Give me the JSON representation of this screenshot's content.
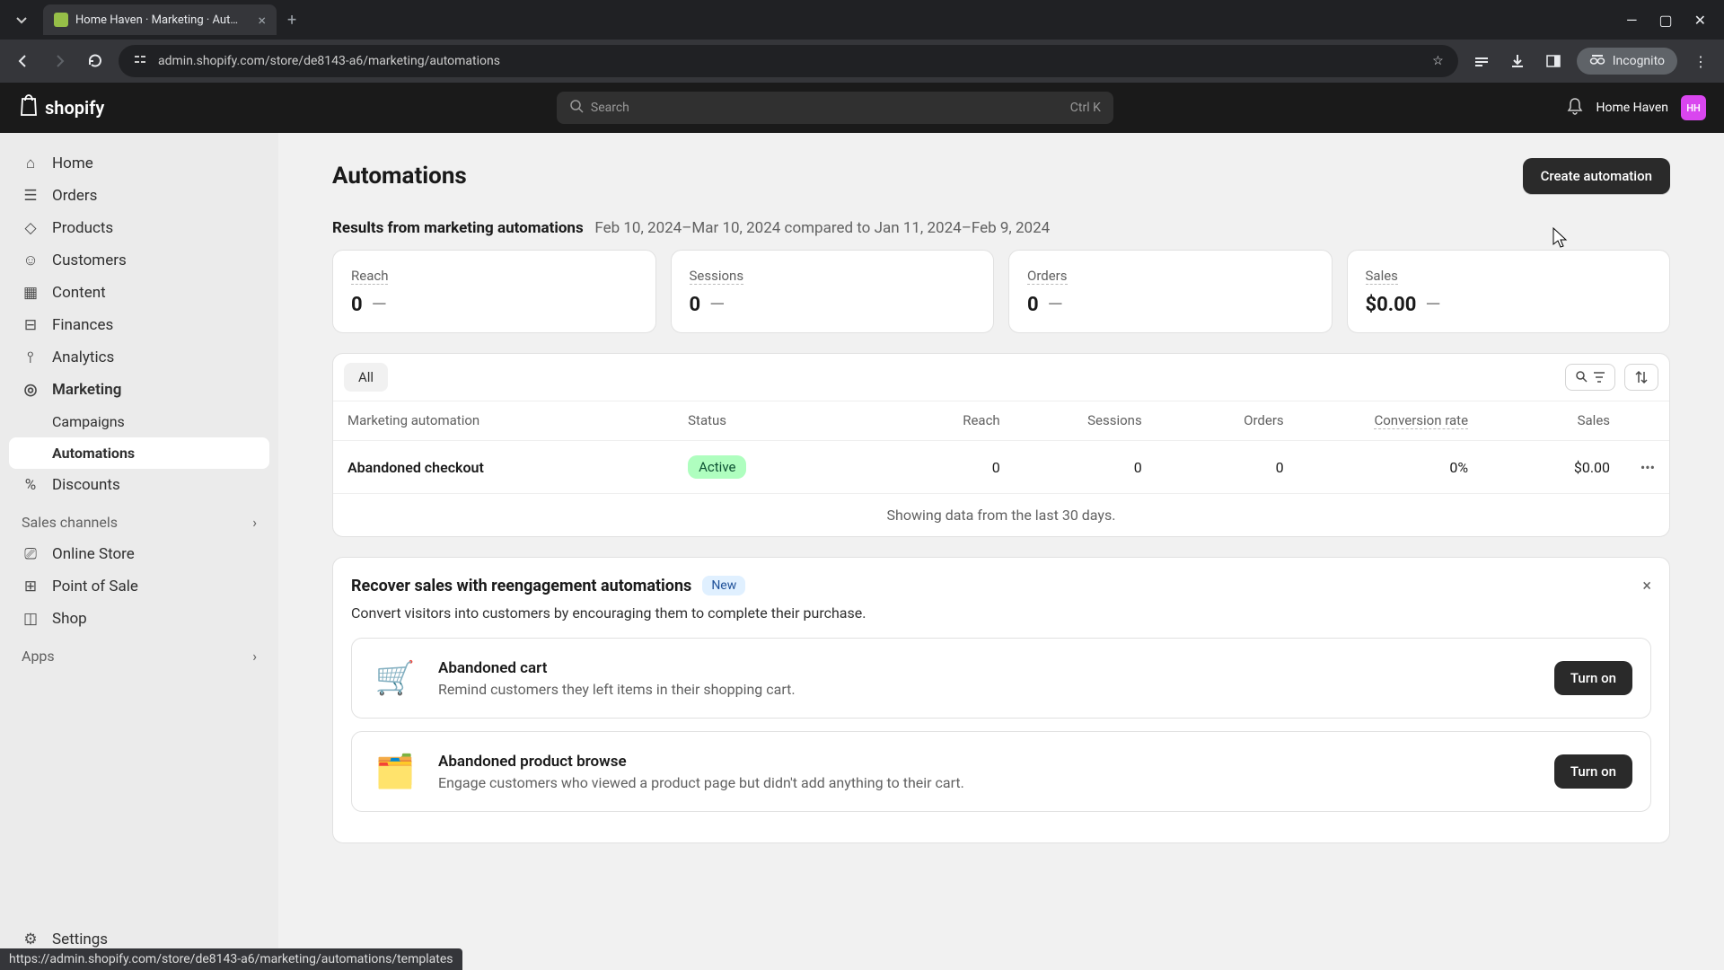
{
  "browser": {
    "tab_title": "Home Haven · Marketing · Aut…",
    "url": "admin.shopify.com/store/de8143-a6/marketing/automations",
    "incognito": "Incognito",
    "status_url": "https://admin.shopify.com/store/de8143-a6/marketing/automations/templates"
  },
  "header": {
    "logo": "shopify",
    "search_placeholder": "Search",
    "search_shortcut": "Ctrl K",
    "store_name": "Home Haven",
    "avatar_initials": "HH"
  },
  "sidebar": {
    "items": [
      {
        "label": "Home"
      },
      {
        "label": "Orders"
      },
      {
        "label": "Products"
      },
      {
        "label": "Customers"
      },
      {
        "label": "Content"
      },
      {
        "label": "Finances"
      },
      {
        "label": "Analytics"
      },
      {
        "label": "Marketing"
      }
    ],
    "marketing_sub": [
      {
        "label": "Campaigns"
      },
      {
        "label": "Automations"
      }
    ],
    "discounts": "Discounts",
    "sales_channels": "Sales channels",
    "channels": [
      {
        "label": "Online Store"
      },
      {
        "label": "Point of Sale"
      },
      {
        "label": "Shop"
      }
    ],
    "apps": "Apps",
    "settings": "Settings"
  },
  "page": {
    "title": "Automations",
    "create_btn": "Create automation",
    "results_label": "Results from marketing automations",
    "results_date": "Feb 10, 2024–Mar 10, 2024 compared to Jan 11, 2024–Feb 9, 2024"
  },
  "metrics": [
    {
      "label": "Reach",
      "value": "0",
      "delta": "—"
    },
    {
      "label": "Sessions",
      "value": "0",
      "delta": "—"
    },
    {
      "label": "Orders",
      "value": "0",
      "delta": "—"
    },
    {
      "label": "Sales",
      "value": "$0.00",
      "delta": "—"
    }
  ],
  "table": {
    "filter_all": "All",
    "headers": {
      "name": "Marketing automation",
      "status": "Status",
      "reach": "Reach",
      "sessions": "Sessions",
      "orders": "Orders",
      "conversion": "Conversion rate",
      "sales": "Sales"
    },
    "rows": [
      {
        "name": "Abandoned checkout",
        "status": "Active",
        "reach": "0",
        "sessions": "0",
        "orders": "0",
        "conversion": "0%",
        "sales": "$0.00"
      }
    ],
    "footer": "Showing data from the last 30 days."
  },
  "promo": {
    "title": "Recover sales with reengagement automations",
    "badge": "New",
    "desc": "Convert visitors into customers by encouraging them to complete their purchase.",
    "items": [
      {
        "title": "Abandoned cart",
        "desc": "Remind customers they left items in their shopping cart.",
        "btn": "Turn on"
      },
      {
        "title": "Abandoned product browse",
        "desc": "Engage customers who viewed a product page but didn't add anything to their cart.",
        "btn": "Turn on"
      }
    ]
  }
}
